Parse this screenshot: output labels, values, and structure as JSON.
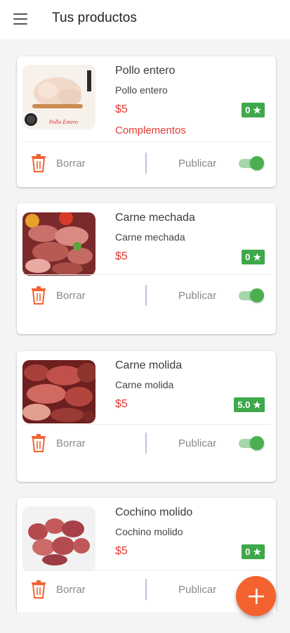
{
  "header": {
    "title": "Tus productos",
    "menu_icon": "menu-icon"
  },
  "labels": {
    "delete": "Borrar",
    "publish": "Publicar"
  },
  "colors": {
    "price": "#e53935",
    "rating_badge": "#3ea84b",
    "toggle_on": "#4caf50",
    "fab": "#f4622f"
  },
  "products": [
    {
      "name": "Pollo entero",
      "description": "Pollo entero",
      "price": "$5",
      "rating": "0",
      "extra": "Complementos",
      "published": true,
      "image_caption": "Pollo Entero"
    },
    {
      "name": "Carne mechada",
      "description": "Carne mechada",
      "price": "$5",
      "rating": "0",
      "published": true
    },
    {
      "name": "Carne molida",
      "description": "Carne molida",
      "price": "$5",
      "rating": "5.0",
      "published": true
    },
    {
      "name": "Cochino molido",
      "description": "Cochino molido",
      "price": "$5",
      "rating": "0",
      "published": true
    }
  ],
  "fab": {
    "icon": "plus-icon"
  }
}
